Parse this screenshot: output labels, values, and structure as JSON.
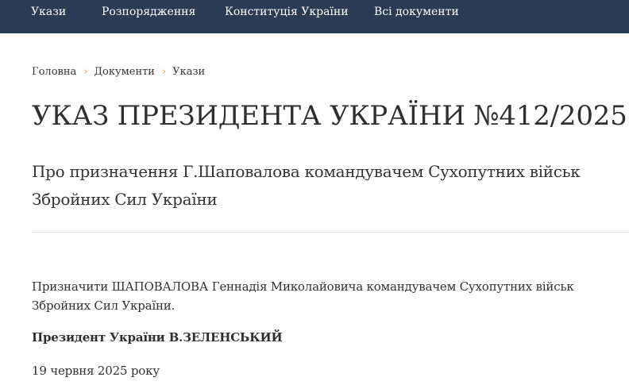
{
  "nav": {
    "items": [
      {
        "label": "Укази"
      },
      {
        "label": "Розпорядження"
      },
      {
        "label": "Конституція України"
      },
      {
        "label": "Всі документи"
      }
    ]
  },
  "breadcrumb": {
    "items": [
      {
        "label": "Головна"
      },
      {
        "label": "Документи"
      },
      {
        "label": "Укази"
      }
    ],
    "separator": "›"
  },
  "document": {
    "title": "УКАЗ ПРЕЗИДЕНТА УКРАЇНИ №412/2025",
    "subtitle": "Про призначення Г.Шаповалова командувачем Сухопутних військ Збройних Сил України",
    "body": "Призначити ШАПОВАЛОВА Геннадія Миколайовича командувачем Сухопутних військ Збройних Сил України.",
    "signature": "Президент України В.ЗЕЛЕНСЬКИЙ",
    "date": "19 червня 2025 року"
  },
  "colors": {
    "nav_background": "#2b3a55",
    "breadcrumb_separator": "#e0b43a",
    "text": "#333333",
    "divider": "#e3e3e3"
  }
}
